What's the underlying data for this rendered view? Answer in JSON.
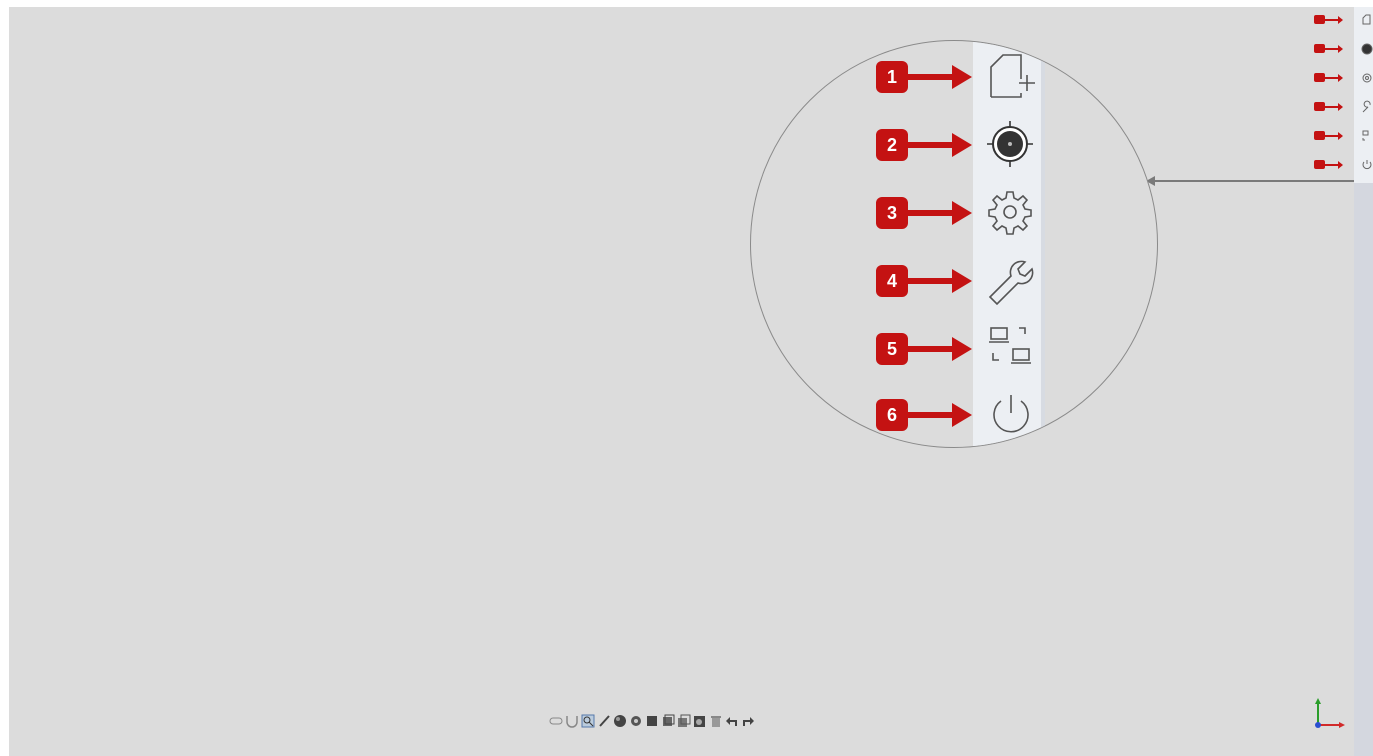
{
  "callouts": [
    {
      "number": "1",
      "icon": "new-file-icon"
    },
    {
      "number": "2",
      "icon": "target-icon"
    },
    {
      "number": "3",
      "icon": "gear-icon"
    },
    {
      "number": "4",
      "icon": "wrench-icon"
    },
    {
      "number": "5",
      "icon": "view-switch-icon"
    },
    {
      "number": "6",
      "icon": "power-icon"
    }
  ],
  "colors": {
    "canvas": "#dcdcdc",
    "toolbar": "#eceff3",
    "callout_red": "#c41212",
    "icon_gray": "#555555"
  },
  "bottom_toolbar": {
    "icons": [
      "select-icon",
      "magnet-icon",
      "zoom-icon",
      "brush-icon",
      "sphere-icon",
      "rotate-icon",
      "box-icon",
      "cube-icon",
      "layer-icon",
      "fill-icon",
      "delete-icon",
      "undo-icon",
      "redo-icon"
    ]
  },
  "axes": {
    "icon": "axes-gizmo-icon"
  }
}
